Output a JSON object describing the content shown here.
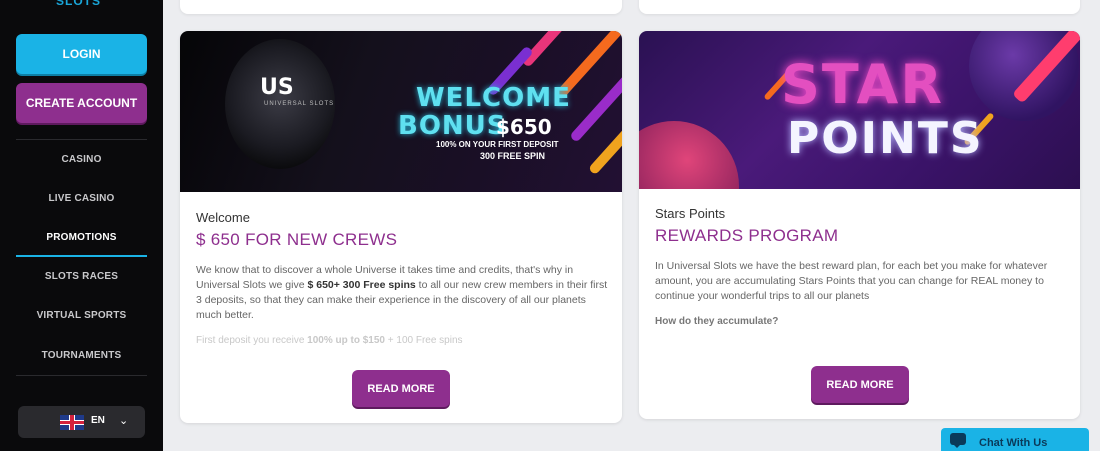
{
  "sidebar": {
    "logo_text": "SLOTS",
    "login": "LOGIN",
    "create_account": "CREATE ACCOUNT",
    "nav": [
      {
        "label": "CASINO"
      },
      {
        "label": "LIVE CASINO"
      },
      {
        "label": "PROMOTIONS",
        "active": true
      },
      {
        "label": "SLOTS RACES"
      },
      {
        "label": "VIRTUAL SPORTS"
      },
      {
        "label": "TOURNAMENTS"
      }
    ],
    "language": "EN"
  },
  "cards": [
    {
      "banner": {
        "logo": "US",
        "logo_sub": "UNIVERSAL SLOTS",
        "line1": "WELCOME",
        "line2": "BONUS",
        "amount": "$650",
        "small1": "100% ON YOUR FIRST DEPOSIT",
        "small2": "300 FREE SPIN"
      },
      "pretitle": "Welcome",
      "title": "$ 650 FOR NEW CREWS",
      "body_p1": "We know that to discover a whole Universe it takes time and credits, that's why in Universal Slots we give ",
      "body_bold": "$ 650+ 300 Free spins",
      "body_p2": " to all our new crew members in their first 3 deposits, so that they can make their experience in the discovery of all our planets much better.",
      "fade_prefix": "First deposit you receive ",
      "fade_bold": "100% up to $150",
      "fade_suffix": " + 100 Free spins",
      "read_more": "READ MORE"
    },
    {
      "banner": {
        "line1": "STAR",
        "line2": "POINTS"
      },
      "pretitle": "Stars Points",
      "title": "REWARDS PROGRAM",
      "body": "In Universal Slots we have the best reward plan, for each bet you make for whatever amount, you are accumulating Stars Points that you can change for REAL money to continue your wonderful trips to all our planets",
      "question": "How do they accumulate?",
      "read_more": "READ MORE"
    }
  ],
  "chat": {
    "label": "Chat With Us"
  },
  "colors": {
    "primary_purple": "#8e2f8e",
    "accent_blue": "#1ab3e6",
    "sidebar_bg": "#0a0a0c"
  }
}
